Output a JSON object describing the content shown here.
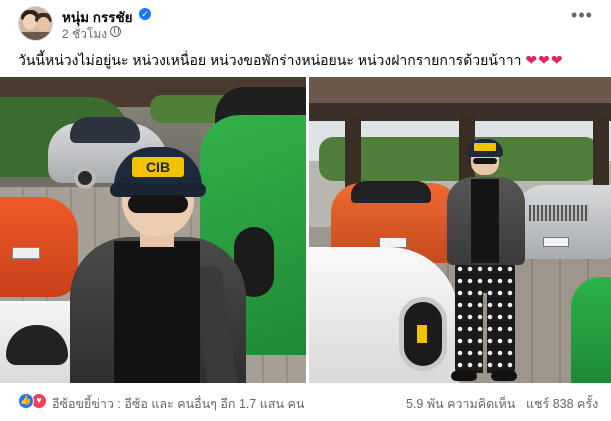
{
  "post": {
    "author": "หนุ่ม กรรชัย",
    "time": "2 ชั่วโมง ·",
    "caption": "วันนี้หน่วงไม่อยู่นะ หน่วงเหนื่อย หน่วงขอพักร่างหน่อยนะ หน่วงฝากรายการด้วยน้าาา",
    "caption_emoji": "❤❤❤",
    "more_glyph": "•••",
    "verified_glyph": "✓",
    "icons": {
      "verified": "verified-badge-icon",
      "privacy": "globe-icon",
      "more": "more-options-icon",
      "like": "like-reaction-icon",
      "love": "love-reaction-icon"
    }
  },
  "photos": {
    "left": {
      "cap_text": "CIB"
    },
    "right": {}
  },
  "footer": {
    "reactors": "อีซ้อขยี้ข่าว : อีซ้อ และ คนอื่นๆ อีก 1.7 แสน คน",
    "comments": "5.9 พัน ความคิดเห็น",
    "shares": "แชร์ 838 ครั้ง",
    "like_glyph": "👍",
    "love_glyph": "♥"
  },
  "colors": {
    "accent": "#1877f2",
    "love": "#f33e58",
    "secondary_text": "#65676b"
  }
}
